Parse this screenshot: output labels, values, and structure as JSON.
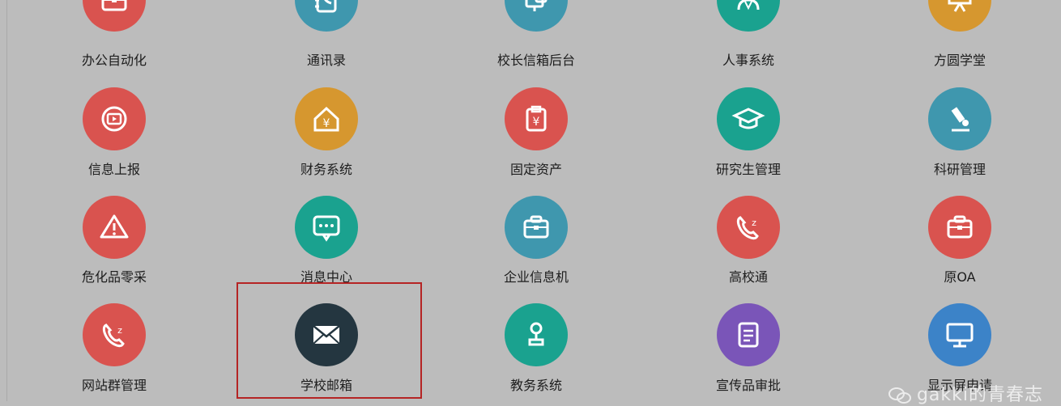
{
  "apps": [
    {
      "label": "办公自动化",
      "icon": "briefcase-icon",
      "color": "#d9534f"
    },
    {
      "label": "通讯录",
      "icon": "contacts-icon",
      "color": "#3f97ae"
    },
    {
      "label": "校长信箱后台",
      "icon": "mailbox-icon",
      "color": "#3f97ae"
    },
    {
      "label": "人事系统",
      "icon": "people-icon",
      "color": "#1aa28f"
    },
    {
      "label": "方圆学堂",
      "icon": "easel-icon",
      "color": "#d6972f"
    },
    {
      "label": "信息上报",
      "icon": "screen-icon",
      "color": "#d9534f"
    },
    {
      "label": "财务系统",
      "icon": "yuan-house-icon",
      "color": "#d6972f"
    },
    {
      "label": "固定资产",
      "icon": "yuan-clipboard-icon",
      "color": "#d9534f"
    },
    {
      "label": "研究生管理",
      "icon": "graduation-cap-icon",
      "color": "#1aa28f"
    },
    {
      "label": "科研管理",
      "icon": "microscope-icon",
      "color": "#3f97ae"
    },
    {
      "label": "危化品零采",
      "icon": "warning-icon",
      "color": "#d9534f"
    },
    {
      "label": "消息中心",
      "icon": "chat-icon",
      "color": "#1aa28f"
    },
    {
      "label": "企业信息机",
      "icon": "briefcase-icon",
      "color": "#3f97ae"
    },
    {
      "label": "高校通",
      "icon": "phone-icon",
      "color": "#d9534f"
    },
    {
      "label": "原OA",
      "icon": "briefcase-icon",
      "color": "#d9534f"
    },
    {
      "label": "网站群管理",
      "icon": "phone-icon",
      "color": "#d9534f"
    },
    {
      "label": "学校邮箱",
      "icon": "mail-icon",
      "color": "#243640"
    },
    {
      "label": "教务系统",
      "icon": "stamp-icon",
      "color": "#1aa28f"
    },
    {
      "label": "宣传品审批",
      "icon": "document-icon",
      "color": "#7a55b8"
    },
    {
      "label": "显示屏申请",
      "icon": "monitor-icon",
      "color": "#3c83c8"
    }
  ],
  "watermark": {
    "text": "gakki的青春志"
  }
}
